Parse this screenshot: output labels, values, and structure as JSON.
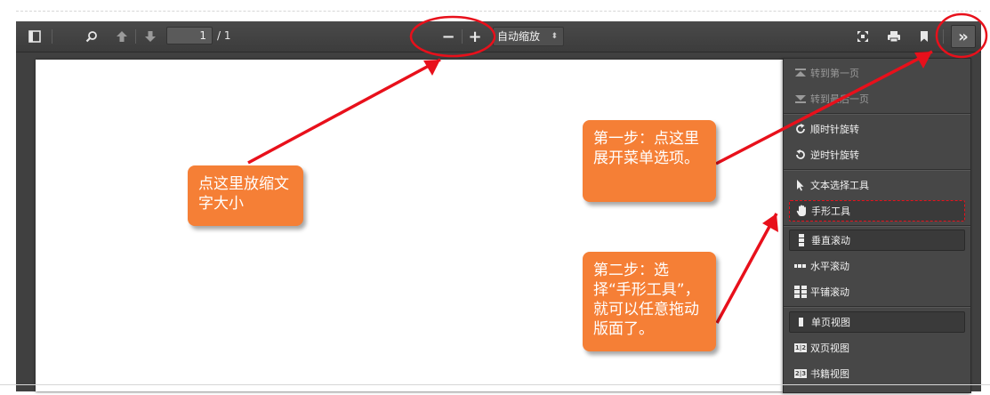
{
  "toolbar": {
    "page_number": "1",
    "page_total": "/ 1",
    "zoom_out_label": "−",
    "zoom_in_label": "+",
    "zoom_value": "自动缩放",
    "zoom_caret": "⬍",
    "more_label": "»"
  },
  "menu": {
    "items": [
      {
        "label": "转到第一页",
        "icon": "first-page-icon"
      },
      {
        "label": "转到最后一页",
        "icon": "last-page-icon"
      },
      {
        "label": "顺时针旋转",
        "icon": "rotate-cw-icon"
      },
      {
        "label": "逆时针旋转",
        "icon": "rotate-ccw-icon"
      },
      {
        "label": "文本选择工具",
        "icon": "cursor-icon"
      },
      {
        "label": "手形工具",
        "icon": "hand-icon"
      },
      {
        "label": "垂直滚动",
        "icon": "vertical-scroll-icon"
      },
      {
        "label": "水平滚动",
        "icon": "horizontal-scroll-icon"
      },
      {
        "label": "平铺滚动",
        "icon": "wrapped-scroll-icon"
      },
      {
        "label": "单页视图",
        "icon": "single-page-icon"
      },
      {
        "label": "双页视图",
        "icon": "odd-spread-icon"
      },
      {
        "label": "书籍视图",
        "icon": "even-spread-icon"
      }
    ],
    "odd_spread_glyph": "1|2",
    "even_spread_glyph": "2|3"
  },
  "callouts": {
    "zoom": "点这里放缩文字大小",
    "step1": "第一步：点这里展开菜单选项。",
    "step2": "第二步：选择“手形工具”，就可以任意拖动版面了。"
  },
  "colors": {
    "callout": "#f57f36",
    "annotation": "#e8101b",
    "toolbar": "#404040"
  }
}
